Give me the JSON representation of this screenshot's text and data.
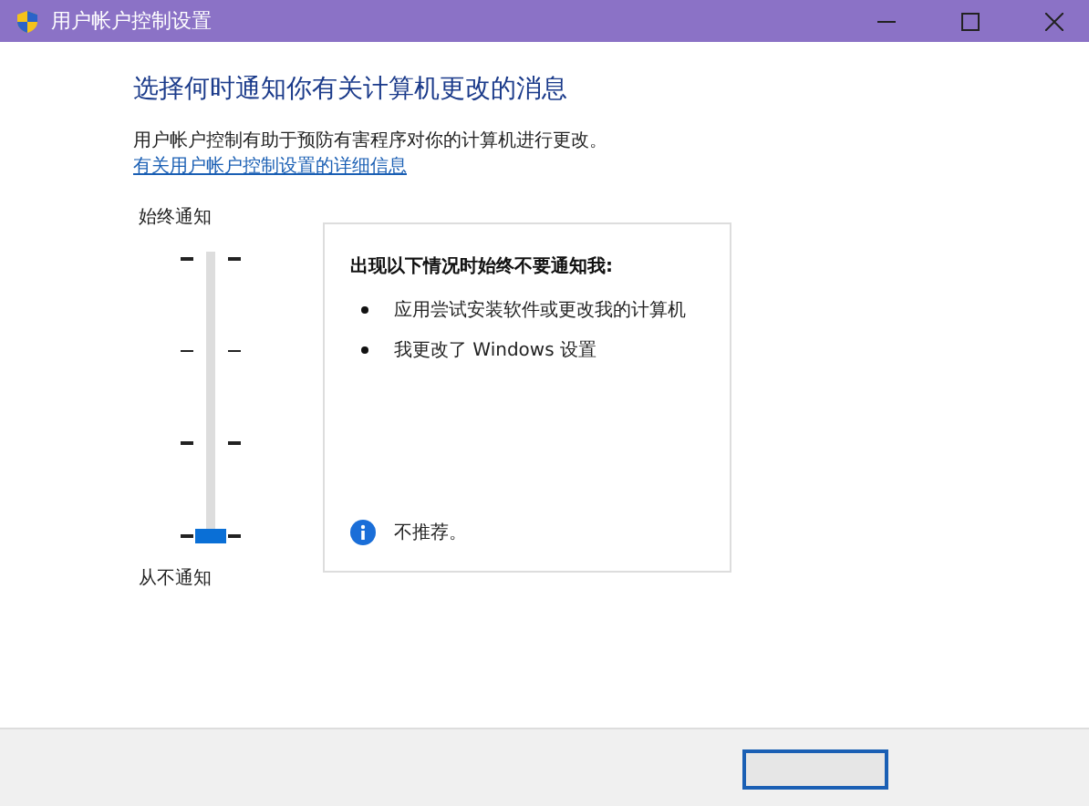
{
  "window": {
    "title": "用户帐户控制设置"
  },
  "heading": "选择何时通知你有关计算机更改的消息",
  "description": "用户帐户控制有助于预防有害程序对你的计算机进行更改。",
  "link": "有关用户帐户控制设置的详细信息",
  "slider": {
    "top_label": "始终通知",
    "bottom_label": "从不通知",
    "level": 0
  },
  "info_panel": {
    "title": "出现以下情况时始终不要通知我:",
    "items": [
      "应用尝试安装软件或更改我的计算机",
      "我更改了 Windows 设置"
    ],
    "note": "不推荐。"
  }
}
